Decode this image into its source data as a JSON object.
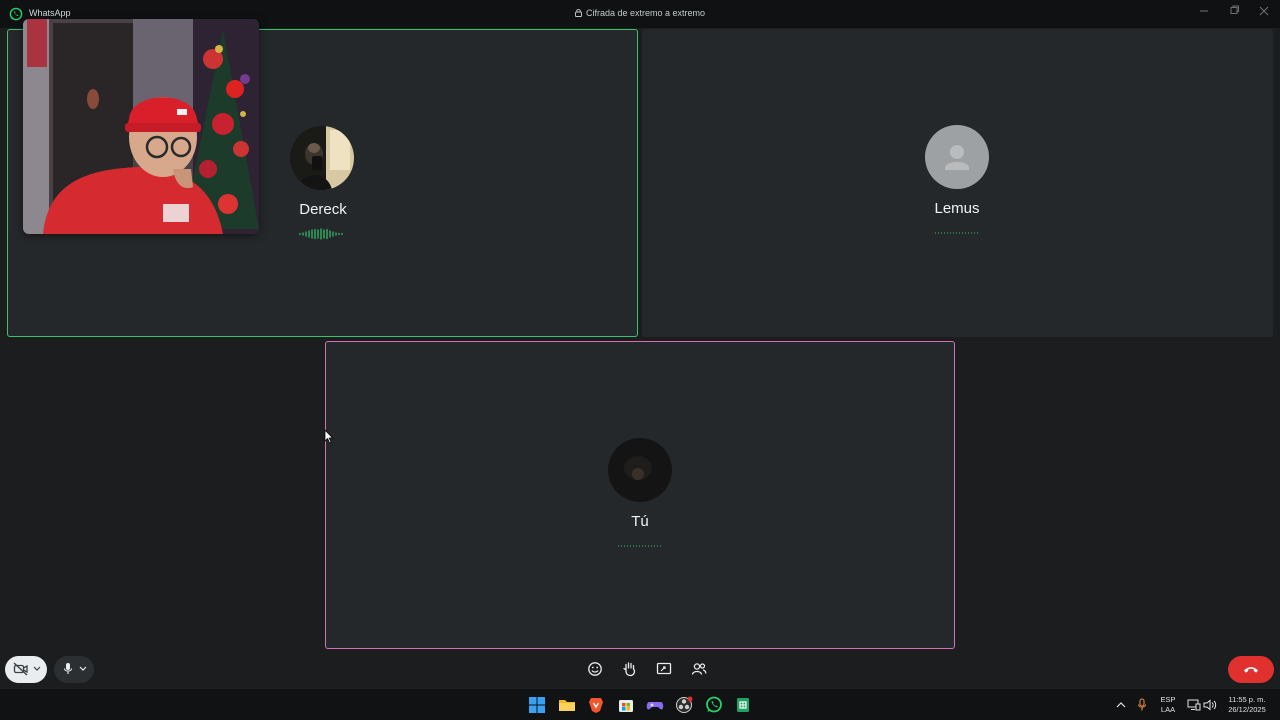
{
  "window": {
    "app_name": "WhatsApp",
    "encryption_notice": "Cifrada de extremo a extremo"
  },
  "participants": [
    {
      "name": "Dereck",
      "speaking": true,
      "border_color": "#35c46a"
    },
    {
      "name": "Lemus",
      "speaking": false
    },
    {
      "name": "Tú",
      "speaking": false,
      "border_color": "#d86fb6"
    }
  ],
  "controls": {
    "camera": "camera-off-icon",
    "microphone": "microphone-icon",
    "center_buttons": [
      "emoji-icon",
      "raise-hand-icon",
      "share-screen-icon",
      "add-participant-icon"
    ],
    "end_call": "end-call-icon",
    "end_call_color": "#e0312f"
  },
  "taskbar": {
    "apps": [
      "windows-start-icon",
      "file-explorer-icon",
      "brave-icon",
      "store-icon",
      "game-icon",
      "obs-icon",
      "whatsapp-icon",
      "sheets-icon"
    ],
    "language_line1": "ESP",
    "language_line2": "LAA",
    "time": "11:55 p. m.",
    "date": "26/12/2025"
  }
}
